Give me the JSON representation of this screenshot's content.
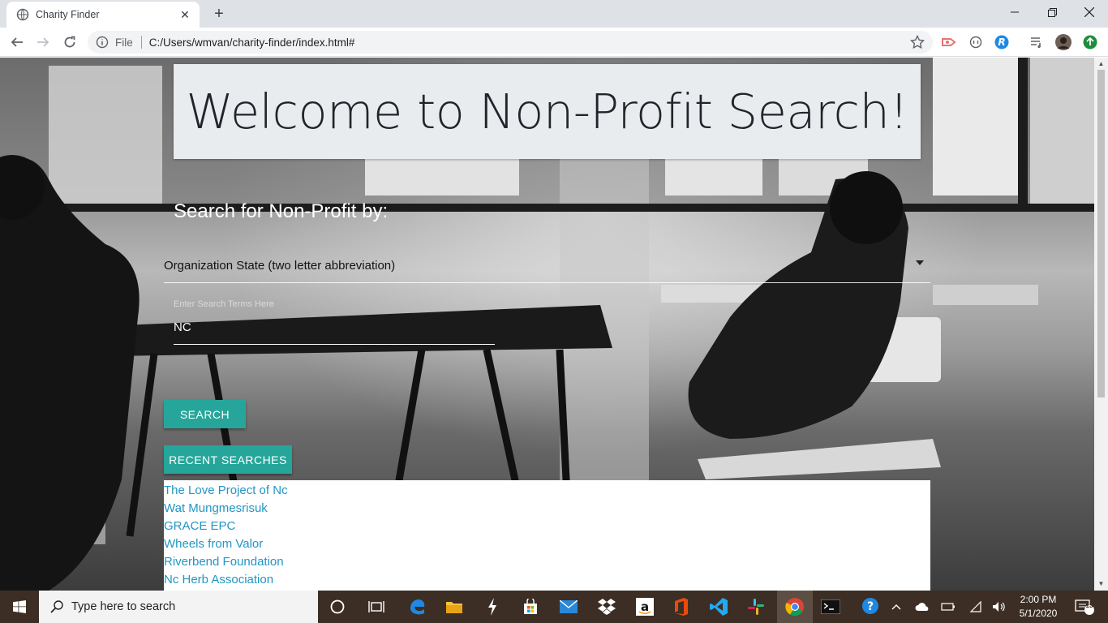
{
  "browser": {
    "tab_title": "Charity Finder",
    "url_scheme": "File",
    "url": "C:/Users/wmvan/charity-finder/index.html#"
  },
  "page": {
    "hero_title": "Welcome to Non-Profit Search!",
    "search_label": "Search for Non-Profit by:",
    "select_value": "Organization State (two letter abbreviation)",
    "term_placeholder": "Enter Search Terms Here",
    "term_value": "NC",
    "search_button": "SEARCH",
    "recent_button": "RECENT SEARCHES",
    "recent_searches": [
      "The Love Project of Nc",
      "Wat Mungmesrisuk",
      "GRACE EPC",
      "Wheels from Valor",
      "Riverbend Foundation",
      "Nc Herb Association"
    ],
    "colors": {
      "accent": "#26a69a",
      "link": "#2196c4",
      "hero_bg": "#e9ecef"
    }
  },
  "taskbar": {
    "search_placeholder": "Type here to search",
    "time": "2:00 PM",
    "date": "5/1/2020",
    "notification_count": "13",
    "icons": [
      "windows-start-icon",
      "cortana-icon",
      "task-view-icon",
      "edge-icon",
      "file-explorer-icon",
      "ide-icon",
      "store-icon",
      "mail-icon",
      "dropbox-icon",
      "amazon-icon",
      "office-icon",
      "vscode-icon",
      "slack-icon",
      "chrome-icon",
      "terminal-icon",
      "help-icon"
    ]
  }
}
